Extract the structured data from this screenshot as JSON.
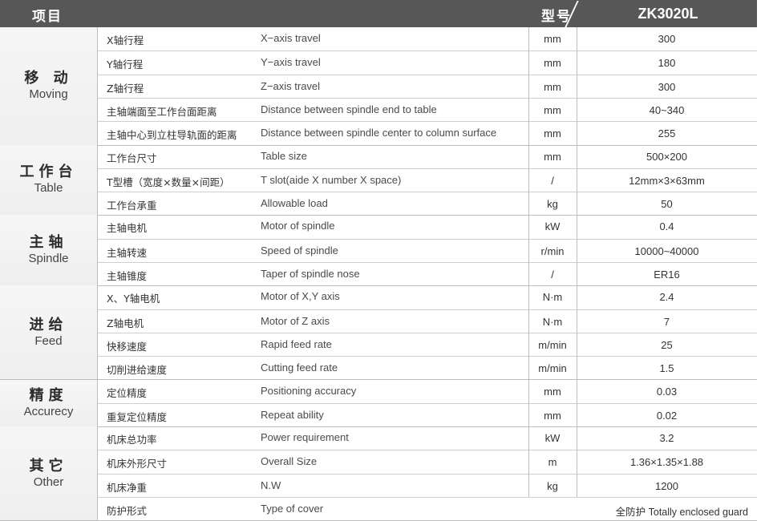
{
  "header": {
    "item": "项目",
    "type": "型号",
    "model": "ZK3020L"
  },
  "groups": [
    {
      "zh": "移 动",
      "en": "Moving",
      "rows": [
        {
          "zh": "X轴行程",
          "en": "X−axis travel",
          "unit": "mm",
          "val": "300"
        },
        {
          "zh": "Y轴行程",
          "en": "Y−axis travel",
          "unit": "mm",
          "val": "180"
        },
        {
          "zh": "Z轴行程",
          "en": "Z−axis travel",
          "unit": "mm",
          "val": "300"
        },
        {
          "zh": "主轴端面至工作台面距离",
          "en": "Distance between spindle end to table",
          "unit": "mm",
          "val": "40~340"
        },
        {
          "zh": "主轴中心到立柱导轨面的距离",
          "en": "Distance between spindle center to column surface",
          "unit": "mm",
          "val": "255"
        }
      ]
    },
    {
      "zh": "工作台",
      "en": "Table",
      "rows": [
        {
          "zh": "工作台尺寸",
          "en": "Table size",
          "unit": "mm",
          "val": "500×200"
        },
        {
          "zh": "T型槽（宽度×数量×间距）",
          "en": "T slot(aide X number X space)",
          "unit": "/",
          "val": "12mm×3×63mm"
        },
        {
          "zh": "工作台承重",
          "en": "Allowable load",
          "unit": "kg",
          "val": "50"
        }
      ]
    },
    {
      "zh": "主轴",
      "en": "Spindle",
      "rows": [
        {
          "zh": "主轴电机",
          "en": "Motor of spindle",
          "unit": "kW",
          "val": "0.4"
        },
        {
          "zh": "主轴转速",
          "en": "Speed of spindle",
          "unit": "r/min",
          "val": "10000~40000"
        },
        {
          "zh": "主轴锥度",
          "en": "Taper of spindle nose",
          "unit": "/",
          "val": "ER16"
        }
      ]
    },
    {
      "zh": "进给",
      "en": "Feed",
      "rows": [
        {
          "zh": "X、Y轴电机",
          "en": "Motor of X,Y axis",
          "unit": "N·m",
          "val": "2.4"
        },
        {
          "zh": "Z轴电机",
          "en": "Motor of Z axis",
          "unit": "N·m",
          "val": "7"
        },
        {
          "zh": "快移速度",
          "en": "Rapid feed rate",
          "unit": "m/min",
          "val": "25"
        },
        {
          "zh": "切削进给速度",
          "en": "Cutting feed rate",
          "unit": "m/min",
          "val": "1.5"
        }
      ]
    },
    {
      "zh": "精度",
      "en": "Accurecy",
      "rows": [
        {
          "zh": "定位精度",
          "en": "Positioning accuracy",
          "unit": "mm",
          "val": "0.03"
        },
        {
          "zh": "重复定位精度",
          "en": "Repeat ability",
          "unit": "mm",
          "val": "0.02"
        }
      ]
    },
    {
      "zh": "其它",
      "en": "Other",
      "rows": [
        {
          "zh": "机床总功率",
          "en": "Power requirement",
          "unit": "kW",
          "val": "3.2"
        },
        {
          "zh": "机床外形尺寸",
          "en": "Overall Size",
          "unit": "m",
          "val": "1.36×1.35×1.88"
        },
        {
          "zh": "机床净重",
          "en": "N.W",
          "unit": "kg",
          "val": "1200"
        },
        {
          "zh": "防护形式",
          "en": "Type of cover",
          "unit": "",
          "val": "全防护   Totally enclosed guard"
        }
      ]
    }
  ]
}
